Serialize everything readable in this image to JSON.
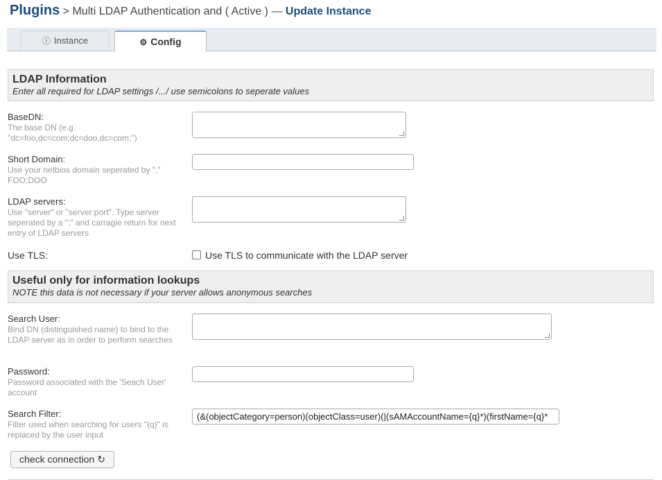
{
  "header": {
    "plugins": "Plugins",
    "crumb": " > Multi LDAP Authentication and ( Active ) — ",
    "title": "Update Instance"
  },
  "tabs": {
    "instance": {
      "icon": "info-circle-icon",
      "label": "Instance"
    },
    "config": {
      "icon": "cog-icon",
      "label": "Config"
    }
  },
  "sections": {
    "ldap": {
      "heading": "LDAP Information",
      "subtitle": "Enter all required for LDAP settings /.../ use semicolons to seperate values"
    },
    "lookup": {
      "heading": "Useful only for information lookups",
      "subtitle": "NOTE this data is not necessary if your server allows anonymous searches"
    }
  },
  "fields": {
    "basedn": {
      "label": "BaseDN:",
      "desc": "The base DN (e.g. \"dc=foo,dc=com;dc=doo,dc=com;\")",
      "value": ""
    },
    "short_domain": {
      "label": "Short Domain:",
      "desc": "Use your netbios domain seperated by \",\" FOO;DOO",
      "value": ""
    },
    "ldap_servers": {
      "label": "LDAP servers:",
      "desc": "Use \"server\" or \"server:port\". Type server seperated by a \";\" and carragie return for next entry of LDAP servers",
      "value": ""
    },
    "use_tls": {
      "label": "Use TLS:",
      "checkbox_label": "Use TLS to communicate with the LDAP server",
      "checked": false
    },
    "search_user": {
      "label": "Search User:",
      "desc": "Bind DN (distinguished name) to bind to the LDAP server as in order to perform searches",
      "value": ""
    },
    "password": {
      "label": "Password:",
      "desc": "Password associated with the 'Seach User' account",
      "value": ""
    },
    "search_filter": {
      "label": "Search Filter:",
      "desc": "Filter used when searching for users \"{q}\" is replaced by the user input",
      "value": "(&(objectCategory=person)(objectClass=user)(|(sAMAccountName={q}*)(firstName={q}*"
    }
  },
  "buttons": {
    "check_connection": {
      "label": "check connection",
      "icon": "refresh-icon"
    }
  },
  "colors": {
    "brand": "#1a4d7c",
    "section_bg": "#efefef",
    "tab_active_border": "#7aa7d1"
  }
}
